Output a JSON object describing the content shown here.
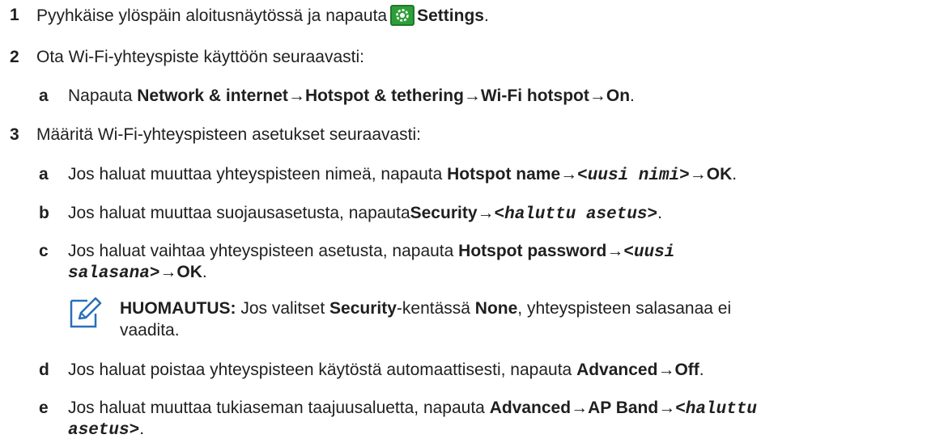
{
  "step1": {
    "num": "1",
    "text": "Pyyhkäise ylöspäin aloitusnäytössä ja napauta",
    "settings": "Settings",
    "end": "."
  },
  "step2": {
    "num": "2",
    "text": "Ota Wi-Fi-yhteyspiste käyttöön seuraavasti:",
    "a": {
      "letter": "a",
      "pre": "Napauta ",
      "p1": "Network & internet",
      "arrow1": "→",
      "p2": "Hotspot & tethering",
      "arrow2": "→",
      "p3": "Wi-Fi hotspot",
      "arrow3": "→",
      "p4": "On",
      "end": "."
    }
  },
  "step3": {
    "num": "3",
    "text": "Määritä Wi-Fi-yhteyspisteen asetukset seuraavasti:",
    "a": {
      "letter": "a",
      "pre": "Jos haluat muuttaa yhteyspisteen nimeä, napauta ",
      "p1": "Hotspot name",
      "arrow1": "→",
      "v1": "<uusi nimi>",
      "arrow2": "→",
      "p2": "OK",
      "end": "."
    },
    "b": {
      "letter": "b",
      "pre": "Jos haluat muuttaa suojausasetusta, napauta",
      "p1": "Security",
      "arrow1": "→",
      "v1": "<haluttu asetus>",
      "end": "."
    },
    "c": {
      "letter": "c",
      "pre": "Jos haluat vaihtaa yhteyspisteen asetusta, napauta ",
      "p1": "Hotspot password",
      "arrow1": "→",
      "v1a": "<uusi",
      "v1b": "salasana>",
      "arrow2": "→",
      "p2": "OK",
      "end": "."
    },
    "note": {
      "label": "HUOMAUTUS:",
      "t1": " Jos valitset ",
      "security": "Security",
      "t2": "-kentässä ",
      "none": "None",
      "t3": ", yhteyspisteen salasanaa ei",
      "t4": "vaadita."
    },
    "d": {
      "letter": "d",
      "pre": "Jos haluat poistaa yhteyspisteen käytöstä automaattisesti, napauta ",
      "p1": "Advanced",
      "arrow1": "→",
      "p2": "Off",
      "end": "."
    },
    "e": {
      "letter": "e",
      "pre": "Jos haluat muuttaa tukiaseman taajuusaluetta, napauta ",
      "p1": "Advanced",
      "arrow1": "→",
      "p2": "AP Band",
      "arrow2": "→",
      "v1a": "<haluttu",
      "v1b": "asetus>",
      "end": "."
    }
  },
  "icons": {
    "settings_icon": "settings-gear-icon",
    "note_icon": "pencil-note-icon",
    "settings_icon_color": "#2e9e3a"
  }
}
